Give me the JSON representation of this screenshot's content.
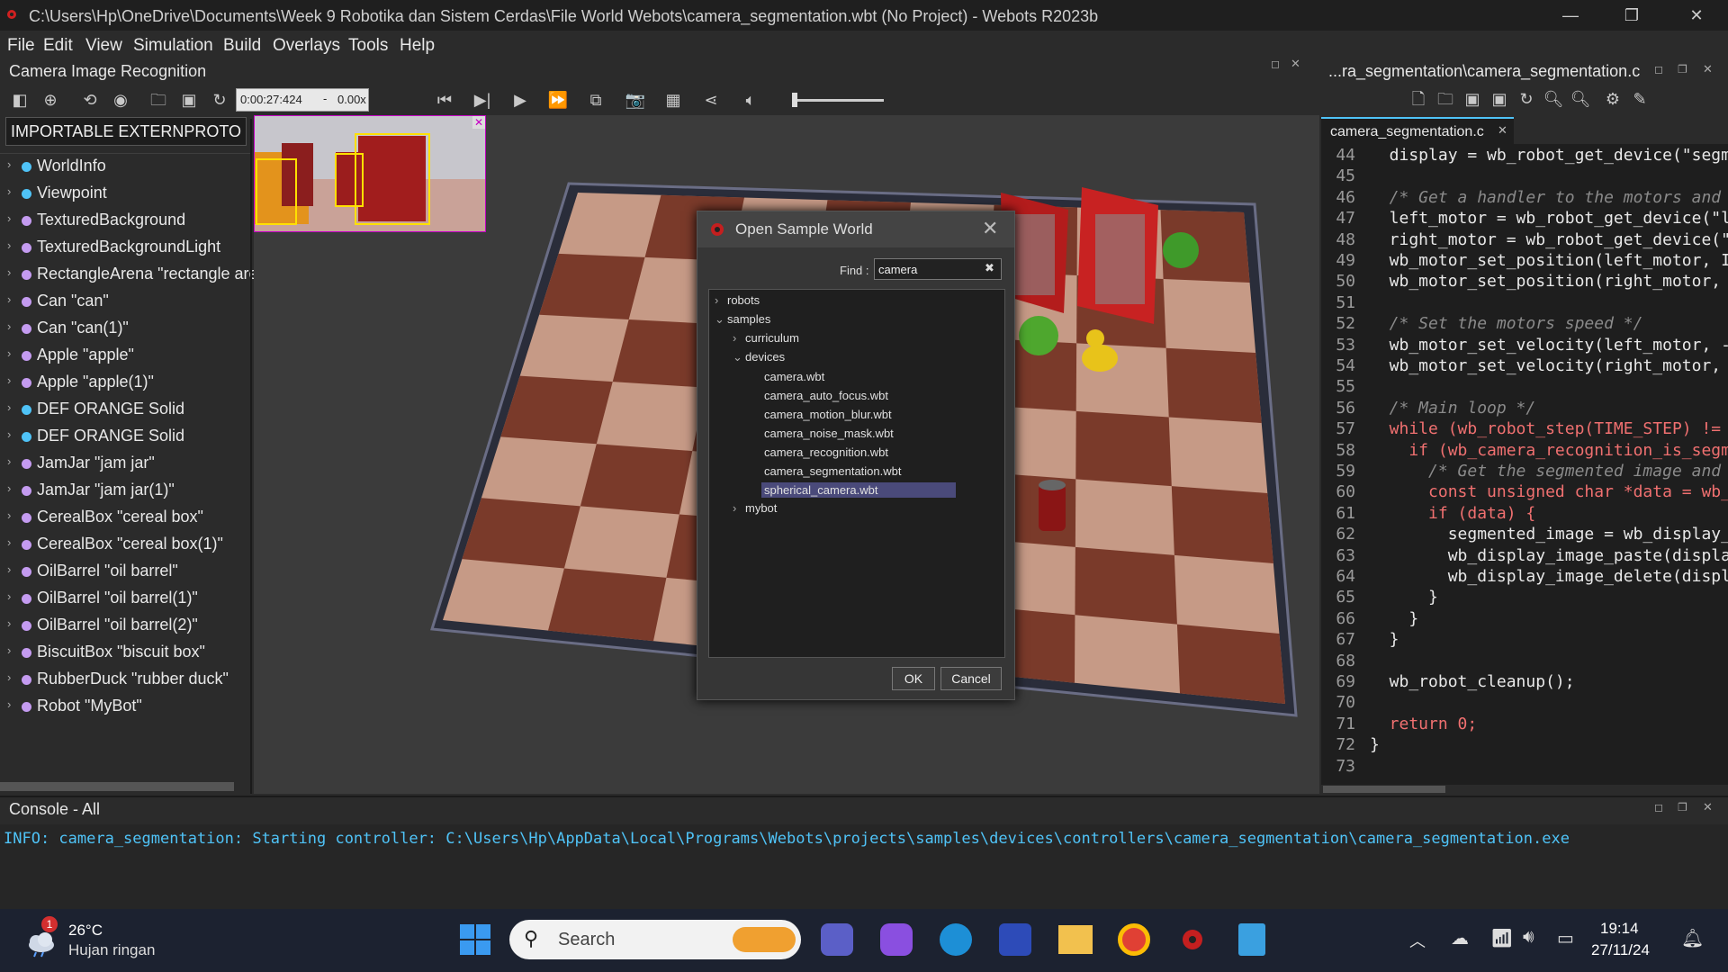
{
  "window": {
    "title": "C:\\Users\\Hp\\OneDrive\\Documents\\Week 9 Robotika dan Sistem Cerdas\\File World Webots\\camera_segmentation.wbt (No Project) - Webots R2023b",
    "minimize": "—",
    "maximize": "❐",
    "close": "✕"
  },
  "menu": [
    "File",
    "Edit",
    "View",
    "Simulation",
    "Build",
    "Overlays",
    "Tools",
    "Help"
  ],
  "scene_tree": {
    "title": "Camera Image Recognition",
    "header_button": "IMPORTABLE EXTERNPROTO",
    "items": [
      {
        "label": "WorldInfo",
        "color": "#4fc3f7"
      },
      {
        "label": "Viewpoint",
        "color": "#4fc3f7"
      },
      {
        "label": "TexturedBackground",
        "color": "#c49bf0"
      },
      {
        "label": "TexturedBackgroundLight",
        "color": "#c49bf0"
      },
      {
        "label": "RectangleArena \"rectangle are",
        "color": "#c49bf0"
      },
      {
        "label": "Can \"can\"",
        "color": "#c49bf0"
      },
      {
        "label": "Can \"can(1)\"",
        "color": "#c49bf0"
      },
      {
        "label": "Apple \"apple\"",
        "color": "#c49bf0"
      },
      {
        "label": "Apple \"apple(1)\"",
        "color": "#c49bf0"
      },
      {
        "label": "DEF ORANGE Solid",
        "color": "#4fc3f7"
      },
      {
        "label": "DEF ORANGE Solid",
        "color": "#4fc3f7"
      },
      {
        "label": "JamJar \"jam jar\"",
        "color": "#c49bf0"
      },
      {
        "label": "JamJar \"jam jar(1)\"",
        "color": "#c49bf0"
      },
      {
        "label": "CerealBox \"cereal box\"",
        "color": "#c49bf0"
      },
      {
        "label": "CerealBox \"cereal box(1)\"",
        "color": "#c49bf0"
      },
      {
        "label": "OilBarrel \"oil barrel\"",
        "color": "#c49bf0"
      },
      {
        "label": "OilBarrel \"oil barrel(1)\"",
        "color": "#c49bf0"
      },
      {
        "label": "OilBarrel \"oil barrel(2)\"",
        "color": "#c49bf0"
      },
      {
        "label": "BiscuitBox \"biscuit box\"",
        "color": "#c49bf0"
      },
      {
        "label": "RubberDuck \"rubber duck\"",
        "color": "#c49bf0"
      },
      {
        "label": "Robot \"MyBot\"",
        "color": "#c49bf0"
      }
    ]
  },
  "toolbar": {
    "time": "0:00:27:424",
    "speed_sep": "-",
    "speed": "0.00x"
  },
  "dialog": {
    "title": "Open Sample World",
    "find_label": "Find :",
    "find_value": "camera",
    "tree": {
      "robots": "robots",
      "samples": "samples",
      "curriculum": "curriculum",
      "devices": "devices",
      "files": [
        "camera.wbt",
        "camera_auto_focus.wbt",
        "camera_motion_blur.wbt",
        "camera_noise_mask.wbt",
        "camera_recognition.wbt",
        "camera_segmentation.wbt",
        "spherical_camera.wbt"
      ],
      "mybot": "mybot"
    },
    "ok": "OK",
    "cancel": "Cancel"
  },
  "editor": {
    "path": "...ra_segmentation\\camera_segmentation.c",
    "tab": "camera_segmentation.c",
    "lines": [
      {
        "n": "44",
        "t": "  display = wb_robot_get_device(\"segm"
      },
      {
        "n": "45",
        "t": ""
      },
      {
        "n": "46",
        "t": "  /* Get a handler to the motors and :"
      },
      {
        "n": "47",
        "t": "  left_motor = wb_robot_get_device(\"l"
      },
      {
        "n": "48",
        "t": "  right_motor = wb_robot_get_device(\"r"
      },
      {
        "n": "49",
        "t": "  wb_motor_set_position(left_motor, II"
      },
      {
        "n": "50",
        "t": "  wb_motor_set_position(right_motor, i"
      },
      {
        "n": "51",
        "t": ""
      },
      {
        "n": "52",
        "t": "  /* Set the motors speed */"
      },
      {
        "n": "53",
        "t": "  wb_motor_set_velocity(left_motor, -!"
      },
      {
        "n": "54",
        "t": "  wb_motor_set_velocity(right_motor, !"
      },
      {
        "n": "55",
        "t": ""
      },
      {
        "n": "56",
        "t": "  /* Main loop */"
      },
      {
        "n": "57",
        "t": "  while (wb_robot_step(TIME_STEP) != -"
      },
      {
        "n": "58",
        "t": "    if (wb_camera_recognition_is_segm"
      },
      {
        "n": "59",
        "t": "      /* Get the segmented image and c"
      },
      {
        "n": "60",
        "t": "      const unsigned char *data = wb_"
      },
      {
        "n": "61",
        "t": "      if (data) {"
      },
      {
        "n": "62",
        "t": "        segmented_image = wb_display_i"
      },
      {
        "n": "63",
        "t": "        wb_display_image_paste(displa"
      },
      {
        "n": "64",
        "t": "        wb_display_image_delete(displa"
      },
      {
        "n": "65",
        "t": "      }"
      },
      {
        "n": "66",
        "t": "    }"
      },
      {
        "n": "67",
        "t": "  }"
      },
      {
        "n": "68",
        "t": ""
      },
      {
        "n": "69",
        "t": "  wb_robot_cleanup();"
      },
      {
        "n": "70",
        "t": ""
      },
      {
        "n": "71",
        "t": "  return 0;"
      },
      {
        "n": "72",
        "t": "}"
      },
      {
        "n": "73",
        "t": ""
      }
    ]
  },
  "console": {
    "title": "Console - All",
    "message": "INFO: camera_segmentation: Starting controller: C:\\Users\\Hp\\AppData\\Local\\Programs\\Webots\\projects\\samples\\devices\\controllers\\camera_segmentation\\camera_segmentation.exe"
  },
  "taskbar": {
    "weather_temp": "26°C",
    "weather_desc": "Hujan ringan",
    "weather_badge": "1",
    "search_placeholder": "Search",
    "time": "19:14",
    "date": "27/11/24"
  },
  "colors": {
    "accent_selection": "#4a4a7a",
    "console_text": "#4fc3f7"
  }
}
